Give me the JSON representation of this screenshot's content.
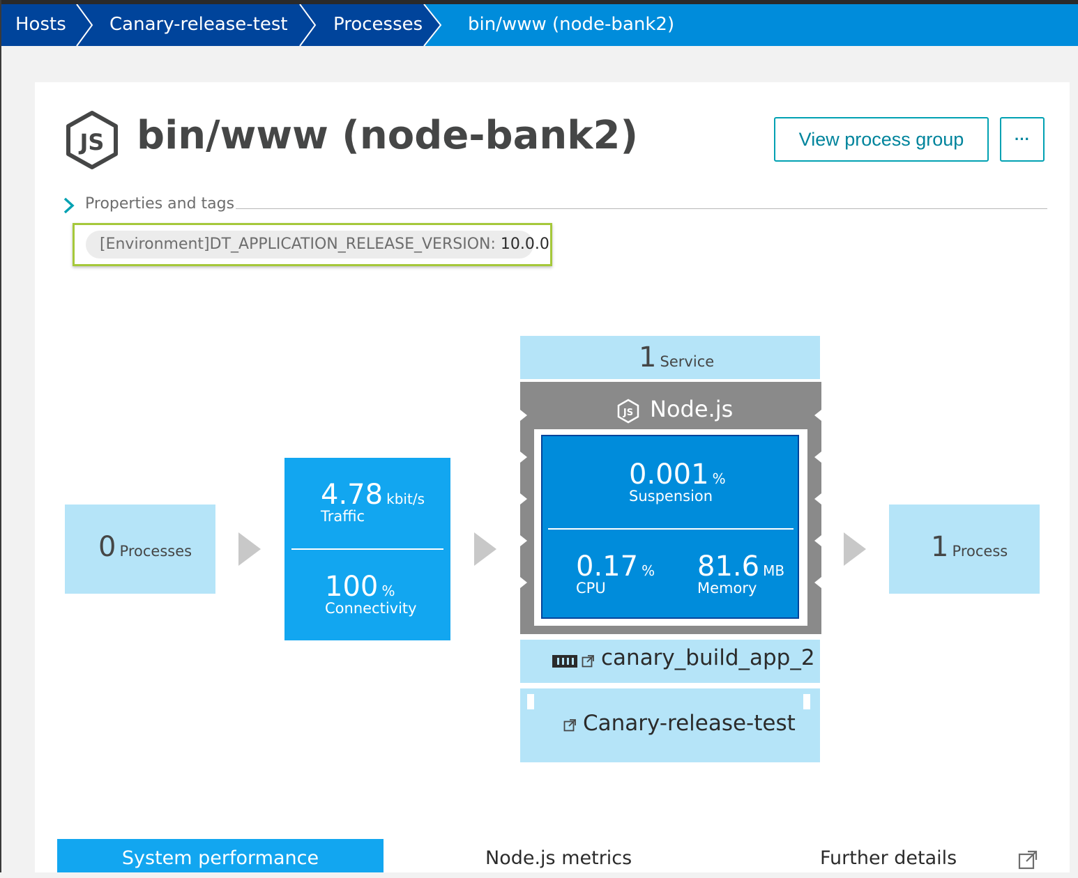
{
  "breadcrumb": {
    "items": [
      {
        "label": "Hosts"
      },
      {
        "label": "Canary-release-test"
      },
      {
        "label": "Processes"
      },
      {
        "label": "bin/www (node-bank2)"
      }
    ]
  },
  "header": {
    "title": "bin/www (node-bank2)",
    "view_process_group_label": "View process group",
    "more_label": "···"
  },
  "properties": {
    "label": "Properties and tags",
    "tag_key": "[Environment]DT_APPLICATION_RELEASE_VERSION:",
    "tag_value": "10.0.0"
  },
  "flow": {
    "incoming": {
      "count": "0",
      "label": "Processes"
    },
    "network": {
      "traffic_value": "4.78",
      "traffic_unit": "kbit/s",
      "traffic_label": "Traffic",
      "connectivity_value": "100",
      "connectivity_unit": "%",
      "connectivity_label": "Connectivity"
    },
    "services": {
      "count": "1",
      "label": "Service"
    },
    "technology": {
      "label": "Node.js"
    },
    "process": {
      "suspension_value": "0.001",
      "suspension_unit": "%",
      "suspension_label": "Suspension",
      "cpu_value": "0.17",
      "cpu_unit": "%",
      "cpu_label": "CPU",
      "memory_value": "81.6",
      "memory_unit": "MB",
      "memory_label": "Memory"
    },
    "process_group": {
      "label": "canary_build_app_2"
    },
    "host": {
      "label": "Canary-release-test"
    },
    "outgoing": {
      "count": "1",
      "label": "Process"
    }
  },
  "tabs": {
    "system_performance": "System performance",
    "nodejs_metrics": "Node.js metrics",
    "further_details": "Further details"
  },
  "colors": {
    "breadcrumb_dark": "#00449b",
    "breadcrumb_active": "#008cdb",
    "accent": "#00a1b2",
    "light_tile": "#b5e4f8",
    "blue_tile": "#12a6f0",
    "tag_highlight": "#a5c83a"
  }
}
